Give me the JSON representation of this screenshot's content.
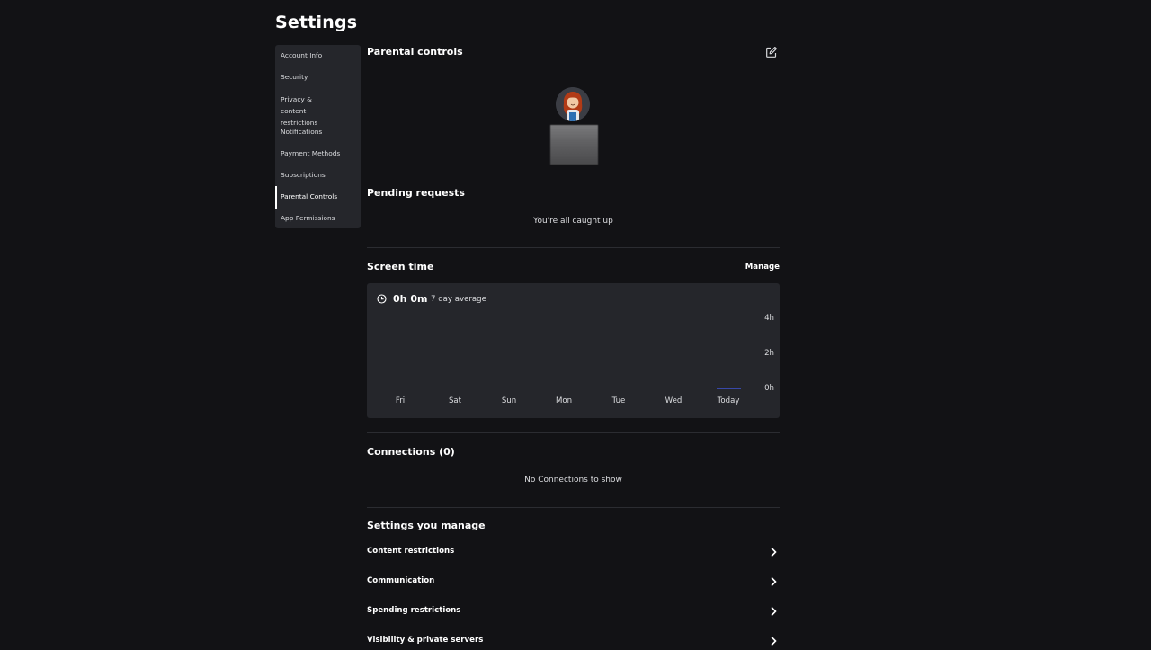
{
  "page": {
    "title": "Settings"
  },
  "sidebar": {
    "items": [
      {
        "label": "Account Info",
        "active": false
      },
      {
        "label": "Security",
        "active": false
      },
      {
        "label": "Privacy & content restrictions",
        "active": false
      },
      {
        "label": "Notifications",
        "active": false
      },
      {
        "label": "Payment Methods",
        "active": false
      },
      {
        "label": "Subscriptions",
        "active": false
      },
      {
        "label": "Parental Controls",
        "active": true
      },
      {
        "label": "App Permissions",
        "active": false
      }
    ]
  },
  "parental": {
    "title": "Parental controls",
    "edit_icon": "edit-icon"
  },
  "pending": {
    "title": "Pending requests",
    "empty_text": "You're all caught up"
  },
  "screen_time": {
    "title": "Screen time",
    "manage_label": "Manage",
    "value": "0h 0m",
    "subtitle": "7 day average",
    "y_ticks": [
      "4h",
      "2h",
      "0h"
    ],
    "days": [
      "Fri",
      "Sat",
      "Sun",
      "Mon",
      "Tue",
      "Wed",
      "Today"
    ],
    "accent_color": "#3848a8"
  },
  "connections": {
    "title": "Connections (0)",
    "empty_text": "No Connections to show"
  },
  "managed_settings": {
    "title": "Settings you manage",
    "items": [
      {
        "label": "Content restrictions"
      },
      {
        "label": "Communication"
      },
      {
        "label": "Spending restrictions"
      },
      {
        "label": "Visibility & private servers"
      }
    ]
  },
  "colors": {
    "background": "#121215",
    "card": "#25262b",
    "divider": "#2b2c31"
  }
}
